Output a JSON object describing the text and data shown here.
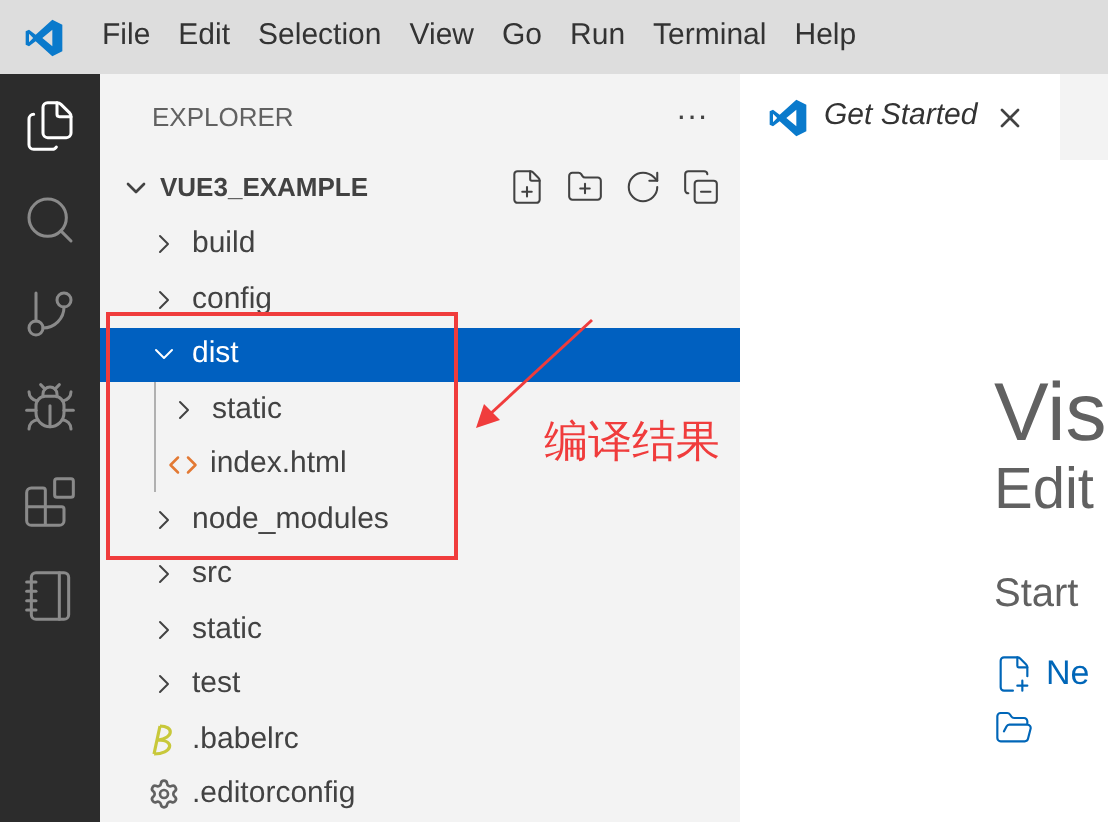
{
  "menu": [
    "File",
    "Edit",
    "Selection",
    "View",
    "Go",
    "Run",
    "Terminal",
    "Help"
  ],
  "activity_bar": [
    {
      "kind": "files",
      "selected": true
    },
    {
      "kind": "search",
      "selected": false
    },
    {
      "kind": "source-control",
      "selected": false
    },
    {
      "kind": "run",
      "selected": false
    },
    {
      "kind": "extensions",
      "selected": false
    },
    {
      "kind": "notebook",
      "selected": false
    }
  ],
  "sidebar": {
    "title": "EXPLORER",
    "more": "···",
    "root": {
      "label": "VUE3_EXAMPLE",
      "expanded": true
    },
    "tree": [
      {
        "label": "build",
        "kind": "folder",
        "expanded": false,
        "selected": false
      },
      {
        "label": "config",
        "kind": "folder",
        "expanded": false,
        "selected": false
      },
      {
        "label": "dist",
        "kind": "folder",
        "expanded": true,
        "selected": true,
        "children": [
          {
            "label": "static",
            "kind": "folder",
            "expanded": false,
            "selected": false
          },
          {
            "label": "index.html",
            "kind": "html",
            "selected": false
          }
        ]
      },
      {
        "label": "node_modules",
        "kind": "folder",
        "expanded": false,
        "selected": false
      },
      {
        "label": "src",
        "kind": "folder",
        "expanded": false,
        "selected": false
      },
      {
        "label": "static",
        "kind": "folder",
        "expanded": false,
        "selected": false
      },
      {
        "label": "test",
        "kind": "folder",
        "expanded": false,
        "selected": false
      },
      {
        "label": ".babelrc",
        "kind": "babel",
        "selected": false
      },
      {
        "label": ".editorconfig",
        "kind": "config",
        "selected": false
      }
    ]
  },
  "annotation": {
    "text": "编译结果"
  },
  "editor": {
    "tab": {
      "label": "Get Started",
      "selected": true
    },
    "heading": "Vis",
    "subheading": "Edit",
    "section": "Start",
    "actions": [
      "Ne"
    ]
  }
}
